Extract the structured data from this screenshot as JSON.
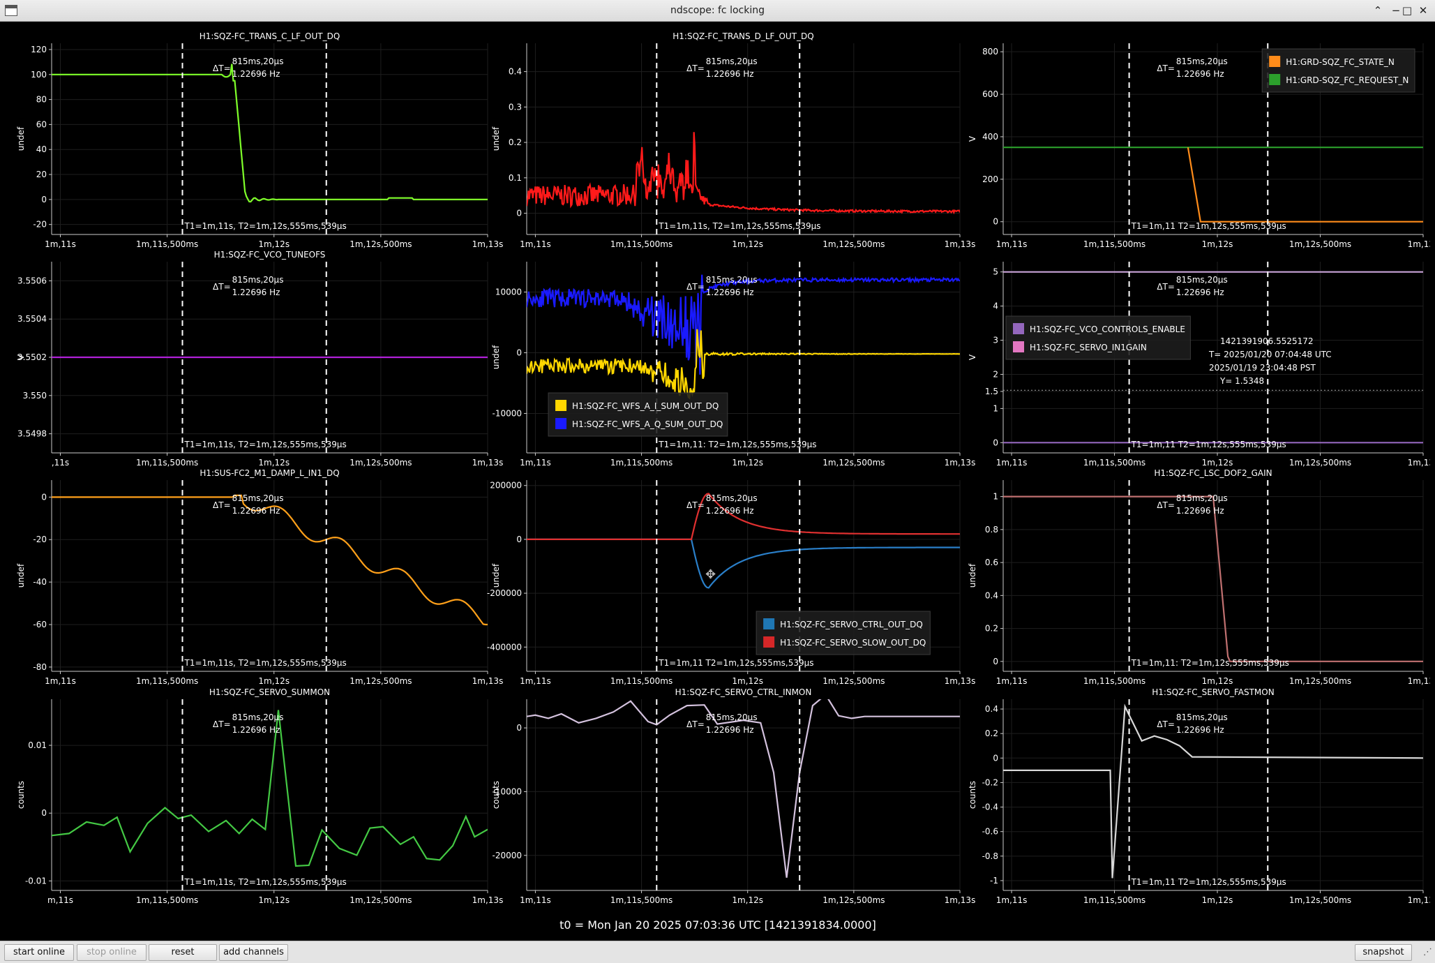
{
  "window": {
    "title": "ndscope: fc locking"
  },
  "colors": {
    "background": "#000000",
    "axis": "#cccccc",
    "grid": "#1e1e1e",
    "cursor": "#ffffff",
    "text": "#ffffff"
  },
  "cursors": {
    "delta_label": "ΔT=",
    "delta_value": "815ms,20μs",
    "freq_value": "1.22696 Hz",
    "t_label_full": "T1=1m,11s, T2=1m,12s,555ms,539μs",
    "t_label_short": "T1=1m,11 T2=1m,12s,555ms,539μs",
    "t_label_cut": "T1=1m,11: T2=1m,12s,555ms,539μs"
  },
  "x_axis_ticks": [
    "1m,11s",
    "1m,11s,500ms",
    "1m,12s",
    "1m,12s,500ms",
    "1m,13s"
  ],
  "t0_label": "t0 = Mon Jan 20 2025 07:03:36 UTC [1421391834.0000]",
  "buttons": {
    "start_online": "start online",
    "stop_online": "stop online",
    "reset": "reset",
    "add_channels": "add channels",
    "snapshot": "snapshot"
  },
  "crosshair_readout": {
    "gps": "1421391906.5525172",
    "utc": "T= 2025/01/20 07:04:48 UTC",
    "local": "2025/01/19 23:04:48 PST",
    "y": "Y= 1.5348"
  },
  "plots": [
    {
      "id": "p1",
      "col": 0,
      "row": 0,
      "title": "H1:SQZ-FC_TRANS_C_LF_OUT_DQ",
      "ylabel": "undef",
      "ylim": [
        -28,
        125
      ],
      "yticks": [
        [
          "-20",
          -20
        ],
        [
          "0",
          0
        ],
        [
          "20",
          20
        ],
        [
          "40",
          40
        ],
        [
          "60",
          60
        ],
        [
          "80",
          80
        ],
        [
          "100",
          100
        ],
        [
          "120",
          120
        ]
      ],
      "first_tick": "1m,11s",
      "tlabel": "full",
      "legend": [],
      "series": [
        {
          "name": "",
          "color": "#7fff2a",
          "gen": "trans_c"
        }
      ]
    },
    {
      "id": "p2",
      "col": 1,
      "row": 0,
      "title": "H1:SQZ-FC_TRANS_D_LF_OUT_DQ",
      "ylabel": "undef",
      "ylim": [
        -0.06,
        0.48
      ],
      "yticks": [
        [
          "0",
          0
        ],
        [
          "0.1",
          0.1
        ],
        [
          "0.2",
          0.2
        ],
        [
          "0.3",
          0.3
        ],
        [
          "0.4",
          0.4
        ]
      ],
      "first_tick": "1m,11s",
      "tlabel": "full",
      "legend": [],
      "series": [
        {
          "name": "",
          "color": "#ff1a1a",
          "gen": "trans_d"
        }
      ]
    },
    {
      "id": "p3",
      "col": 2,
      "row": 0,
      "title": "",
      "ylabel": "V",
      "ylim": [
        -60,
        840
      ],
      "yticks": [
        [
          "0",
          0
        ],
        [
          "200",
          200
        ],
        [
          "400",
          400
        ],
        [
          "600",
          600
        ],
        [
          "800",
          800
        ]
      ],
      "first_tick": "1m,11s",
      "tlabel": "short",
      "legend_pos": "top-right",
      "legend": [
        {
          "name": "H1:GRD-SQZ_FC_STATE_N",
          "color": "#ff8c1a"
        },
        {
          "name": "H1:GRD-SQZ_FC_REQUEST_N",
          "color": "#2ca02c"
        }
      ],
      "series": [
        {
          "name": "H1:GRD-SQZ_FC_REQUEST_N",
          "color": "#2ca02c",
          "gen": "request"
        },
        {
          "name": "H1:GRD-SQZ_FC_STATE_N",
          "color": "#ff8c1a",
          "gen": "state"
        }
      ]
    },
    {
      "id": "p4",
      "col": 0,
      "row": 1,
      "title": "H1:SQZ-FC_VCO_TUNEOFS",
      "ylabel": "V",
      "ylim": [
        3.5497,
        3.5507
      ],
      "yticks": [
        [
          "3.5498",
          3.5498
        ],
        [
          "3.550",
          3.55
        ],
        [
          "3.5502",
          3.5502
        ],
        [
          "3.5504",
          3.5504
        ],
        [
          "3.5506",
          3.5506
        ]
      ],
      "first_tick": ",11s",
      "tlabel": "full",
      "legend": [],
      "series": [
        {
          "name": "",
          "color": "#b020d8",
          "gen": "vco"
        }
      ]
    },
    {
      "id": "p5",
      "col": 1,
      "row": 1,
      "title": "",
      "ylabel": "undef",
      "ylim": [
        -16500,
        15000
      ],
      "yticks": [
        [
          "-10000",
          -10000
        ],
        [
          "0",
          0
        ],
        [
          "10000",
          10000
        ]
      ],
      "first_tick": "1m,11s",
      "tlabel": "cut",
      "legend_pos": "bottom-left",
      "legend": [
        {
          "name": "H1:SQZ-FC_WFS_A_I_SUM_OUT_DQ",
          "color": "#ffd700"
        },
        {
          "name": "H1:SQZ-FC_WFS_A_Q_SUM_OUT_DQ",
          "color": "#1a1aff"
        }
      ],
      "series": [
        {
          "name": "H1:SQZ-FC_WFS_A_Q_SUM_OUT_DQ",
          "color": "#1a1aff",
          "gen": "wfs_q"
        },
        {
          "name": "H1:SQZ-FC_WFS_A_I_SUM_OUT_DQ",
          "color": "#ffd700",
          "gen": "wfs_i"
        }
      ]
    },
    {
      "id": "p6",
      "col": 2,
      "row": 1,
      "title": "",
      "ylabel": "V",
      "ylim": [
        -0.3,
        5.3
      ],
      "yticks": [
        [
          "0",
          0
        ],
        [
          "1",
          1
        ],
        [
          "1.5",
          1.5
        ],
        [
          "2",
          2
        ],
        [
          "3",
          3
        ],
        [
          "4",
          4
        ],
        [
          "5",
          5
        ]
      ],
      "first_tick": "1m,11s",
      "tlabel": "short",
      "legend_pos": "middle-left",
      "crosshair": true,
      "legend": [
        {
          "name": "H1:SQZ-FC_VCO_CONTROLS_ENABLE",
          "color": "#9467bd"
        },
        {
          "name": "H1:SQZ-FC_SERVO_IN1GAIN",
          "color": "#e377c2"
        }
      ],
      "series": [
        {
          "name": "H1:SQZ-FC_SERVO_IN1GAIN",
          "color": "#c9a3d8",
          "gen": "const5"
        },
        {
          "name": "H1:SQZ-FC_VCO_CONTROLS_ENABLE",
          "color": "#9467bd",
          "gen": "const0"
        }
      ]
    },
    {
      "id": "p7",
      "col": 0,
      "row": 2,
      "title": "H1:SUS-FC2_M1_DAMP_L_IN1_DQ",
      "ylabel": "undef",
      "ylim": [
        -82,
        8
      ],
      "yticks": [
        [
          "-80",
          -80
        ],
        [
          "-60",
          -60
        ],
        [
          "-40",
          -40
        ],
        [
          "-20",
          -20
        ],
        [
          "0",
          0
        ]
      ],
      "first_tick": "1m,11s",
      "tlabel": "full",
      "legend": [],
      "series": [
        {
          "name": "",
          "color": "#ffa01a",
          "gen": "damp"
        }
      ]
    },
    {
      "id": "p8",
      "col": 1,
      "row": 2,
      "title": "",
      "ylabel": "undef",
      "ylim": [
        -490000,
        220000
      ],
      "yticks": [
        [
          "-400000",
          -400000
        ],
        [
          "-200000",
          -200000
        ],
        [
          "0",
          0
        ],
        [
          "200000",
          200000
        ]
      ],
      "first_tick": "1m,11s",
      "tlabel": "short",
      "legend_pos": "bottom-right",
      "legend": [
        {
          "name": "H1:SQZ-FC_SERVO_CTRL_OUT_DQ",
          "color": "#1f77b4"
        },
        {
          "name": "H1:SQZ-FC_SERVO_SLOW_OUT_DQ",
          "color": "#d62728"
        }
      ],
      "series": [
        {
          "name": "H1:SQZ-FC_SERVO_CTRL_OUT_DQ",
          "color": "#2a7fc9",
          "gen": "ctrl"
        },
        {
          "name": "H1:SQZ-FC_SERVO_SLOW_OUT_DQ",
          "color": "#e03030",
          "gen": "slow"
        }
      ]
    },
    {
      "id": "p9",
      "col": 2,
      "row": 2,
      "title": "H1:SQZ-FC_LSC_DOF2_GAIN",
      "ylabel": "undef",
      "ylim": [
        -0.06,
        1.1
      ],
      "yticks": [
        [
          "0",
          0
        ],
        [
          "0.2",
          0.2
        ],
        [
          "0.4",
          0.4
        ],
        [
          "0.6",
          0.6
        ],
        [
          "0.8",
          0.8
        ],
        [
          "1",
          1
        ]
      ],
      "first_tick": "1m,11s",
      "tlabel": "cut",
      "legend": [],
      "series": [
        {
          "name": "",
          "color": "#c07070",
          "gen": "dof2"
        }
      ]
    },
    {
      "id": "p10",
      "col": 0,
      "row": 3,
      "title": "H1:SQZ-FC_SERVO_SUMMON",
      "ylabel": "counts",
      "ylim": [
        -0.0114,
        0.0168
      ],
      "yticks": [
        [
          "-0.01",
          -0.01
        ],
        [
          "0",
          0
        ],
        [
          "0.01",
          0.01
        ]
      ],
      "first_tick": "m,11s",
      "tlabel": "full",
      "legend": [],
      "series": [
        {
          "name": "",
          "color": "#44c944",
          "gen": "summon"
        }
      ]
    },
    {
      "id": "p11",
      "col": 1,
      "row": 3,
      "title": "H1:SQZ-FC_SERVO_CTRL_INMON",
      "ylabel": "counts",
      "ylim": [
        -25500,
        4500
      ],
      "yticks": [
        [
          "-20000",
          -20000
        ],
        [
          "-10000",
          -10000
        ],
        [
          "0",
          0
        ]
      ],
      "first_tick": "1m,11s",
      "tlabel": "none",
      "legend": [],
      "series": [
        {
          "name": "",
          "color": "#d4c2de",
          "gen": "inmon"
        }
      ]
    },
    {
      "id": "p12",
      "col": 2,
      "row": 3,
      "title": "H1:SQZ-FC_SERVO_FASTMON",
      "ylabel": "counts",
      "ylim": [
        -1.08,
        0.48
      ],
      "yticks": [
        [
          "-1",
          -1
        ],
        [
          "-0.8",
          -0.8
        ],
        [
          "-0.6",
          -0.6
        ],
        [
          "-0.4",
          -0.4
        ],
        [
          "-0.2",
          -0.2
        ],
        [
          "0",
          0
        ],
        [
          "0.2",
          0.2
        ],
        [
          "0.4",
          0.4
        ]
      ],
      "first_tick": "1m,11s",
      "tlabel": "short",
      "legend": [],
      "series": [
        {
          "name": "",
          "color": "#d8d8d8",
          "gen": "fastmon"
        }
      ]
    }
  ]
}
